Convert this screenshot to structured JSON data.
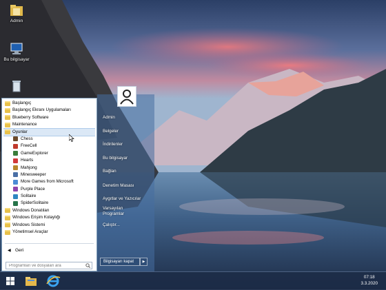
{
  "desktop": {
    "icons": [
      {
        "label": "Admin",
        "icon": "user-folder-icon"
      },
      {
        "label": "Bu bilgisayar",
        "icon": "computer-icon"
      },
      {
        "label": "",
        "icon": "recycle-bin-icon"
      }
    ]
  },
  "start_menu": {
    "programs": [
      {
        "label": "Başlangıç",
        "type": "folder"
      },
      {
        "label": "Başlangıç Ekranı Uygulamaları",
        "type": "folder"
      },
      {
        "label": "Blueberry Software",
        "type": "folder"
      },
      {
        "label": "Maintenance",
        "type": "folder"
      },
      {
        "label": "Oyunlar",
        "type": "folder",
        "selected": true
      },
      {
        "label": "Chess",
        "type": "app",
        "color": "#6b4a2a"
      },
      {
        "label": "FreeCell",
        "type": "app",
        "color": "#c0392b"
      },
      {
        "label": "GameExplorer",
        "type": "app",
        "color": "#3a7d3a"
      },
      {
        "label": "Hearts",
        "type": "app",
        "color": "#d23a3a"
      },
      {
        "label": "Mahjong",
        "type": "app",
        "color": "#b8862b"
      },
      {
        "label": "Minesweeper",
        "type": "app",
        "color": "#4a6fa5"
      },
      {
        "label": "More Games from Microsoft",
        "type": "app",
        "color": "#4c8cd6"
      },
      {
        "label": "Purple Place",
        "type": "app",
        "color": "#8e44ad"
      },
      {
        "label": "Solitaire",
        "type": "app",
        "color": "#2e86c1"
      },
      {
        "label": "SpiderSolitaire",
        "type": "app",
        "color": "#27744a"
      },
      {
        "label": "Windows Donatıları",
        "type": "folder"
      },
      {
        "label": "Windows Erişim Kolaylığı",
        "type": "folder"
      },
      {
        "label": "Windows Sistemi",
        "type": "folder"
      },
      {
        "label": "Yönetimsel Araçlar",
        "type": "folder"
      }
    ],
    "back_label": "Geri",
    "search_placeholder": "Programları ve dosyaları ara",
    "right_items": [
      "Admin",
      "Belgeler",
      "İndirilenler",
      "Bu bilgisayar",
      "Bağlan",
      "Denetim Masası",
      "Aygıtlar ve Yazıcılar",
      "Varsayılan",
      "Programlar",
      "Çalıştır..."
    ],
    "shutdown_label": "Bilgisayarı kapat"
  },
  "taskbar": {
    "time": "07:18",
    "date": "3.3.2020",
    "pinned": [
      "start-button-icon",
      "file-explorer-icon",
      "internet-explorer-icon"
    ]
  }
}
